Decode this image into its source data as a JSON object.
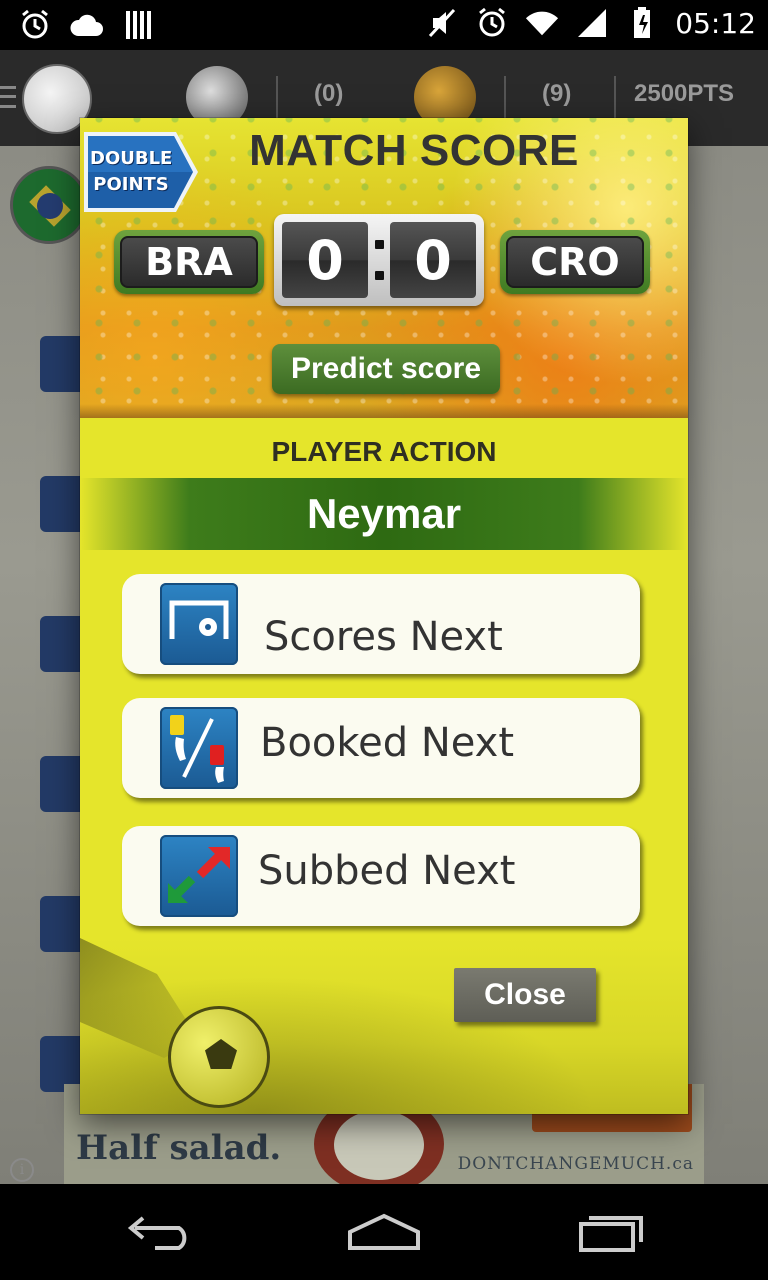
{
  "status_bar": {
    "time": "05:12",
    "left_icons": [
      "alarm-icon",
      "cloud-icon",
      "barcode-icon"
    ],
    "right_icons": [
      "mute-icon",
      "alarm-icon",
      "wifi-icon",
      "signal-icon",
      "battery-icon"
    ]
  },
  "background_app": {
    "topbar": {
      "left_count": "(0)",
      "right_count": "(9)",
      "points": "2500PTS"
    },
    "ad": {
      "text": "Half salad.",
      "brand": "DONTCHANGEMUCH.ca"
    }
  },
  "dialog": {
    "badge": {
      "line1": "DOUBLE",
      "line2": "POINTS"
    },
    "title": "MATCH SCORE",
    "home_team": "BRA",
    "away_team": "CRO",
    "home_score": "0",
    "away_score": "0",
    "predict_label": "Predict score",
    "section_label": "PLAYER ACTION",
    "player_name": "Neymar",
    "actions": [
      {
        "label": "Scores Next",
        "icon": "goal-icon"
      },
      {
        "label": "Booked Next",
        "icon": "cards-icon"
      },
      {
        "label": "Subbed Next",
        "icon": "substitution-icon"
      }
    ],
    "close_label": "Close"
  },
  "nav_bar": {
    "icons": [
      "back-icon",
      "home-icon",
      "recent-apps-icon"
    ]
  },
  "colors": {
    "dialog_yellow": "#e5e52b",
    "team_green": "#4f8a2d",
    "icon_blue": "#1f6aa8",
    "player_band_green": "#2e6a12",
    "close_gray": "#6a6a62"
  }
}
